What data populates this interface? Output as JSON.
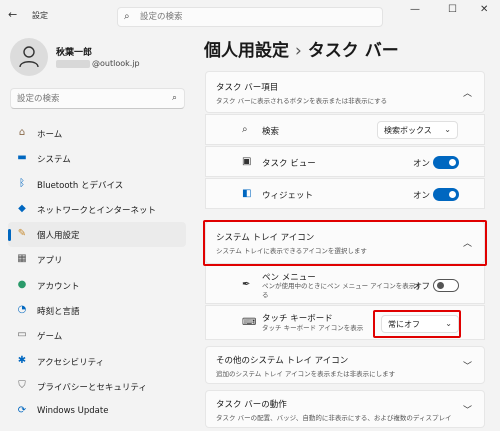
{
  "app": {
    "title": "設定",
    "back_icon": "arrow-left-icon"
  },
  "search": {
    "placeholder": "設定の検索",
    "sidebar_placeholder": "設定の検索"
  },
  "window_controls": {
    "minimize": "—",
    "maximize": "☐",
    "close": "✕"
  },
  "user": {
    "name": "秋葉一郎",
    "email_suffix": "@outlook.jp"
  },
  "nav": {
    "items": [
      {
        "label": "ホーム",
        "icon": "home-icon"
      },
      {
        "label": "システム",
        "icon": "system-icon"
      },
      {
        "label": "Bluetooth とデバイス",
        "icon": "bluetooth-icon"
      },
      {
        "label": "ネットワークとインターネット",
        "icon": "network-icon"
      },
      {
        "label": "個人用設定",
        "icon": "personalization-icon"
      },
      {
        "label": "アプリ",
        "icon": "apps-icon"
      },
      {
        "label": "アカウント",
        "icon": "account-icon"
      },
      {
        "label": "時刻と言語",
        "icon": "time-language-icon"
      },
      {
        "label": "ゲーム",
        "icon": "gaming-icon"
      },
      {
        "label": "アクセシビリティ",
        "icon": "accessibility-icon"
      },
      {
        "label": "プライバシーとセキュリティ",
        "icon": "privacy-icon"
      },
      {
        "label": "Windows Update",
        "icon": "windows-update-icon"
      }
    ],
    "active": "個人用設定"
  },
  "breadcrumb": {
    "parent": "個人用設定",
    "separator": "›",
    "current": "タスク バー"
  },
  "taskbar_items": {
    "title": "タスク バー項目",
    "subtitle": "タスク バーに表示されるボタンを表示または非表示にする",
    "rows": [
      {
        "label": "検索",
        "icon": "search-icon",
        "dropdown_value": "検索ボックス"
      },
      {
        "label": "タスク ビュー",
        "icon": "task-view-icon",
        "state": "オン",
        "toggle": "on"
      },
      {
        "label": "ウィジェット",
        "icon": "widgets-icon",
        "state": "オン",
        "toggle": "on"
      }
    ]
  },
  "system_tray": {
    "title": "システム トレイ アイコン",
    "subtitle": "システム トレイに表示できるアイコンを選択します",
    "rows": [
      {
        "label": "ペン メニュー",
        "icon": "pen-icon",
        "sub": "ペンが使用中のときにペン メニュー アイコンを表示する",
        "state": "オフ",
        "toggle": "off"
      },
      {
        "label": "タッチ キーボード",
        "icon": "keyboard-icon",
        "sub": "タッチ キーボード アイコンを表示",
        "dropdown_value": "常にオフ"
      }
    ]
  },
  "other_tray": {
    "title": "その他のシステム トレイ アイコン",
    "subtitle": "追加のシステム トレイ アイコンを表示または非表示にします"
  },
  "taskbar_behavior": {
    "title": "タスク バーの動作",
    "subtitle": "タスク バーの配置、バッジ、自動的に非表示にする、および複数のディスプレイ"
  },
  "colors": {
    "accent": "#0067c0",
    "highlight": "#e00000"
  }
}
